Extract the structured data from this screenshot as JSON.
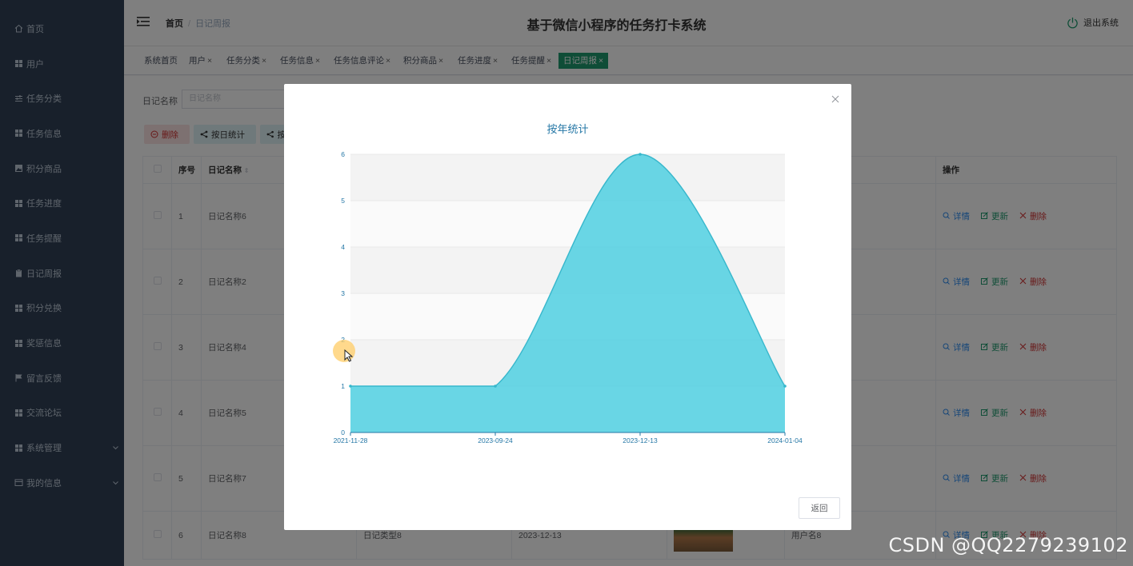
{
  "header": {
    "title": "基于微信小程序的任务打卡系统",
    "breadcrumb_home": "首页",
    "breadcrumb_current": "日记周报",
    "logout": "退出系统"
  },
  "sidebar": {
    "items": [
      {
        "label": "首页",
        "icon": "home-icon"
      },
      {
        "label": "用户",
        "icon": "grid-icon"
      },
      {
        "label": "任务分类",
        "icon": "sliders-icon"
      },
      {
        "label": "任务信息",
        "icon": "grid-icon"
      },
      {
        "label": "积分商品",
        "icon": "image-icon"
      },
      {
        "label": "任务进度",
        "icon": "grid-icon"
      },
      {
        "label": "任务提醒",
        "icon": "grid-icon"
      },
      {
        "label": "日记周报",
        "icon": "clipboard-icon"
      },
      {
        "label": "积分兑换",
        "icon": "grid-icon"
      },
      {
        "label": "奖惩信息",
        "icon": "grid-icon"
      },
      {
        "label": "留言反馈",
        "icon": "flag-icon"
      },
      {
        "label": "交流论坛",
        "icon": "grid-icon"
      },
      {
        "label": "系统管理",
        "icon": "grid-icon",
        "expandable": true
      },
      {
        "label": "我的信息",
        "icon": "card-icon",
        "expandable": true
      }
    ]
  },
  "tags": [
    {
      "label": "系统首页",
      "closable": false
    },
    {
      "label": "用户",
      "closable": true
    },
    {
      "label": "任务分类",
      "closable": true
    },
    {
      "label": "任务信息",
      "closable": true
    },
    {
      "label": "任务信息评论",
      "closable": true
    },
    {
      "label": "积分商品",
      "closable": true
    },
    {
      "label": "任务进度",
      "closable": true
    },
    {
      "label": "任务提醒",
      "closable": true
    },
    {
      "label": "日记周报",
      "closable": true,
      "active": true
    }
  ],
  "tag_close_glyph": "×",
  "search": {
    "label": "日记名称",
    "placeholder": "日记名称"
  },
  "toolbar": {
    "delete": "删除",
    "by_day": "按日统计",
    "by_year_partial": "按"
  },
  "table": {
    "headers": {
      "index": "序号",
      "name": "日记名称",
      "ops": "操作"
    },
    "rows": [
      {
        "index": "1",
        "name": "日记名称6"
      },
      {
        "index": "2",
        "name": "日记名称2"
      },
      {
        "index": "3",
        "name": "日记名称4"
      },
      {
        "index": "4",
        "name": "日记名称5"
      },
      {
        "index": "5",
        "name": "日记名称7"
      },
      {
        "index": "6",
        "name": "日记名称8",
        "type": "日记类型8",
        "date": "2023-12-13",
        "user": "用户名8"
      }
    ],
    "ops": {
      "detail": "详情",
      "update": "更新",
      "delete": "删除"
    }
  },
  "modal": {
    "back": "返回"
  },
  "chart_data": {
    "type": "area",
    "title": "按年统计",
    "x": [
      "2021-11-28",
      "2023-09-24",
      "2023-12-13",
      "2024-01-04"
    ],
    "values": [
      1,
      1,
      6,
      1
    ],
    "ylim": [
      0,
      6
    ],
    "yticks": [
      0,
      1,
      2,
      3,
      4,
      5,
      6
    ],
    "smooth": true,
    "color": "#4fcfe0",
    "line_color": "#37b7cc",
    "axis_text_color": "#2577a6",
    "grid": "alternating horizontal bands"
  },
  "watermark": "CSDN @QQ2279239102"
}
